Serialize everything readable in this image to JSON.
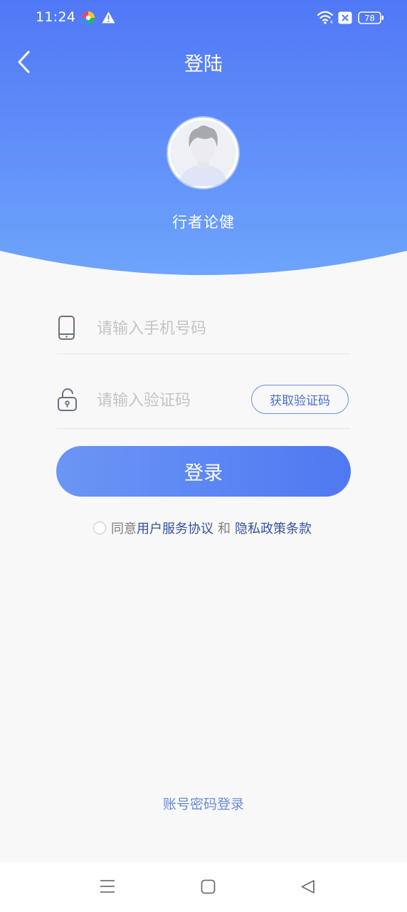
{
  "status_bar": {
    "time": "11:24",
    "battery": "78",
    "icons": [
      "app-colorful-icon",
      "warning-icon",
      "wifi-icon",
      "sim-off-icon",
      "battery-icon"
    ]
  },
  "nav": {
    "title": "登陆",
    "back_icon": "chevron-left-icon"
  },
  "profile": {
    "avatar_icon": "default-avatar",
    "app_name": "行者论健"
  },
  "form": {
    "phone_placeholder": "请输入手机号码",
    "phone_value": "",
    "phone_icon": "phone-icon",
    "code_placeholder": "请输入验证码",
    "code_value": "",
    "code_icon": "unlock-icon",
    "get_code_label": "获取验证码",
    "login_label": "登录"
  },
  "agreement": {
    "prefix": "同意",
    "terms_link": "用户服务协议",
    "conjunction": "和",
    "privacy_link": "隐私政策条款"
  },
  "alt_login": "账号密码登录",
  "system_nav": {
    "icons": [
      "menu-icon",
      "home-square-icon",
      "back-triangle-icon"
    ]
  },
  "colors": {
    "header_gradient_top": "#5178f6",
    "header_gradient_bottom": "#6ea4fb",
    "background": "#f8f8f8",
    "accent": "#5a82f4",
    "link": "#33529a"
  }
}
